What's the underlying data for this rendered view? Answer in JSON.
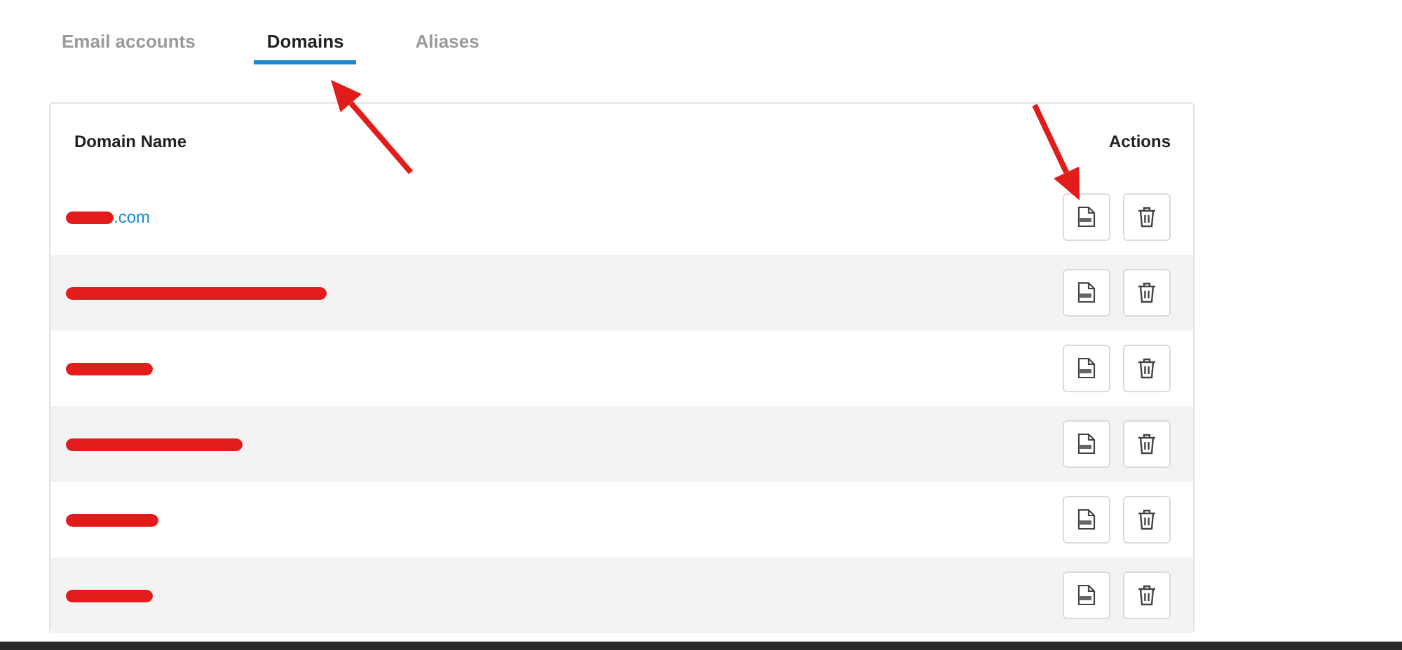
{
  "tabs": [
    {
      "label": "Email accounts",
      "selected": false
    },
    {
      "label": "Domains",
      "selected": true
    },
    {
      "label": "Aliases",
      "selected": false
    }
  ],
  "table": {
    "columns": [
      "Domain Name",
      "Actions"
    ],
    "rows": [
      {
        "domain": ".com",
        "redacted": true
      },
      {
        "redacted": true
      },
      {
        "redacted": true
      },
      {
        "redacted": true
      },
      {
        "redacted": true
      },
      {
        "redacted": true
      }
    ]
  },
  "annotations": [
    {
      "kind": "arrow"
    },
    {
      "kind": "arrow"
    }
  ]
}
